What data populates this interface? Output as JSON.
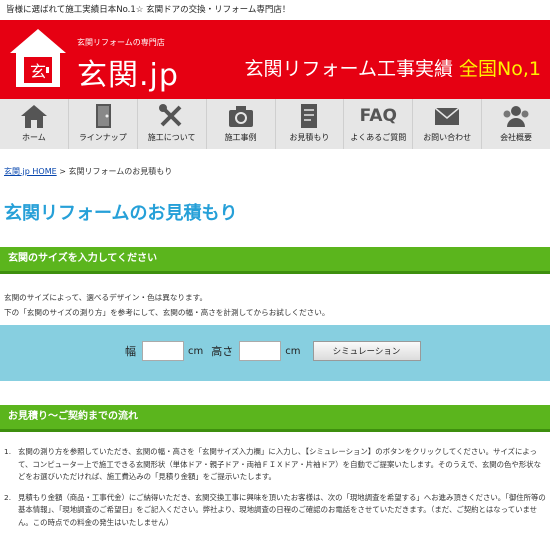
{
  "topbar": {
    "text": "皆様に選ばれて施工実績日本No.1☆ 玄関ドアの交換・リフォーム専門店！"
  },
  "header": {
    "logo_sub": "玄関リフォームの専門店",
    "logo_main": "玄関.jp",
    "tagline_main": "玄関リフォーム工事実績",
    "tagline_highlight": "全国No,1",
    "logo_glyph": "玄"
  },
  "nav": {
    "items": [
      {
        "label": "ホーム",
        "icon": "home-icon"
      },
      {
        "label": "ラインナップ",
        "icon": "door-icon"
      },
      {
        "label": "施工について",
        "icon": "tools-icon"
      },
      {
        "label": "施工事例",
        "icon": "camera-icon"
      },
      {
        "label": "お見積もり",
        "icon": "document-icon"
      },
      {
        "label": "よくあるご質問",
        "icon": "faq-icon",
        "icon_text": "FAQ"
      },
      {
        "label": "お問い合わせ",
        "icon": "mail-icon"
      },
      {
        "label": "会社概要",
        "icon": "people-icon"
      }
    ]
  },
  "breadcrumb": {
    "home": "玄関.jp HOME",
    "separator": " > ",
    "current": "玄関リフォームのお見積もり"
  },
  "page_title": "玄関リフォームのお見積もり",
  "section1": {
    "title": "玄関のサイズを入力してください",
    "desc1": "玄関のサイズによって、選べるデザイン・色は異なります。",
    "desc2": "下の「玄関のサイズの測り方」を参考にして、玄関の幅・高さを計測してからお試しください。"
  },
  "simulator": {
    "width_label": "幅",
    "width_value": "",
    "width_unit": "cm",
    "height_label": "高さ",
    "height_value": "",
    "height_unit": "cm",
    "button_label": "シミュレーション"
  },
  "section2": {
    "title": "お見積り〜ご契約までの流れ",
    "items": [
      {
        "num": "1.",
        "text": "玄関の測り方を参照していただき、玄関の幅・高さを「玄関サイズ入力欄」に入力し、【シミュレーション】のボタンをクリックしてください。サイズによって、コンピューター上で施工できる玄関形状（単体ドア・親子ドア・両袖ＦＩＸドア・片袖ドア）を自動でご提案いたします。そのうえで、玄関の色や形状などをお選びいただければ、施工費込みの「見積り金額」をご提示いたします。"
      },
      {
        "num": "2.",
        "text": "見積もり金額（商品・工事代金）にご納得いただき、玄関交換工事に興味を頂いたお客様は、次の「現地調査を希望する」へお進み頂きください。「御住所等の基本情報」、「現地調査のご希望日」をご記入ください。弊社より、現地調査の日程のご確認のお電話をさせていただきます。（まだ、ご契約とはなっていません。この時点での料金の発生はいたしません）"
      }
    ]
  },
  "colors": {
    "brand_red": "#e60012",
    "highlight_yellow": "#fff200",
    "accent_green": "#5bb51d",
    "title_blue": "#26a0d8",
    "sim_bg": "#87cfe0"
  }
}
